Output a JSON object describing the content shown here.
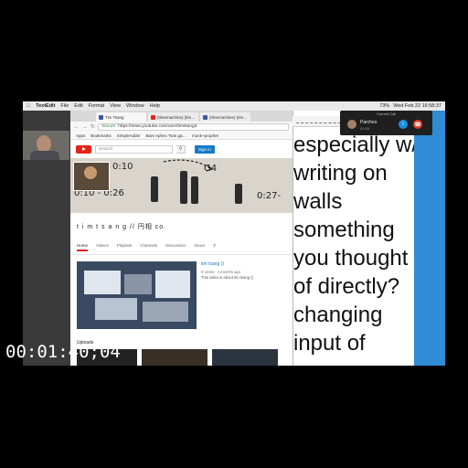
{
  "menubar": {
    "app_name": "TextEdit",
    "menus": [
      "File",
      "Edit",
      "Format",
      "View",
      "Window",
      "Help"
    ],
    "clock": "Wed Feb 22  16:58:37",
    "battery": "73%"
  },
  "browser": {
    "tabs": [
      {
        "label": "Tim Tsang",
        "color": "#3b5998"
      },
      {
        "label": "(timemachine) (tim…",
        "color": "#e62117"
      },
      {
        "label": "(timemachine) (tim…",
        "color": "#3b5998"
      }
    ],
    "secure_label": "Secure",
    "url": "https://www.youtube.com/user/timtsang3",
    "bookmarks": [
      "Apps",
      "Bookmarks",
      "SimpleAdder",
      "Bare Aphex Twin ga…",
      "monk+prophet"
    ]
  },
  "youtube": {
    "search_placeholder": "Search",
    "sign_in": "Sign in",
    "banner_notes": [
      "0:10",
      "G4",
      "0:10 - 0:26",
      "0:27-"
    ],
    "channel_name": "t i m t s a n g // 円相 co.",
    "nav": [
      "Home",
      "Videos",
      "Playlists",
      "Channels",
      "Discussion",
      "About"
    ],
    "featured_video": {
      "title": "tim tsang ()",
      "meta": "6 views · 4 months ago",
      "description": "This video is about tim tsang ()"
    },
    "uploads_label": "Uploads"
  },
  "notes": {
    "lines": [
      "especially w/",
      "writing on",
      "walls",
      "something",
      "you thought",
      "of directly?",
      "changing",
      "input of"
    ]
  },
  "call": {
    "header": "Current Call",
    "name": "Parches",
    "subtitle": "00:00"
  },
  "timecode": "00:01:40;04"
}
